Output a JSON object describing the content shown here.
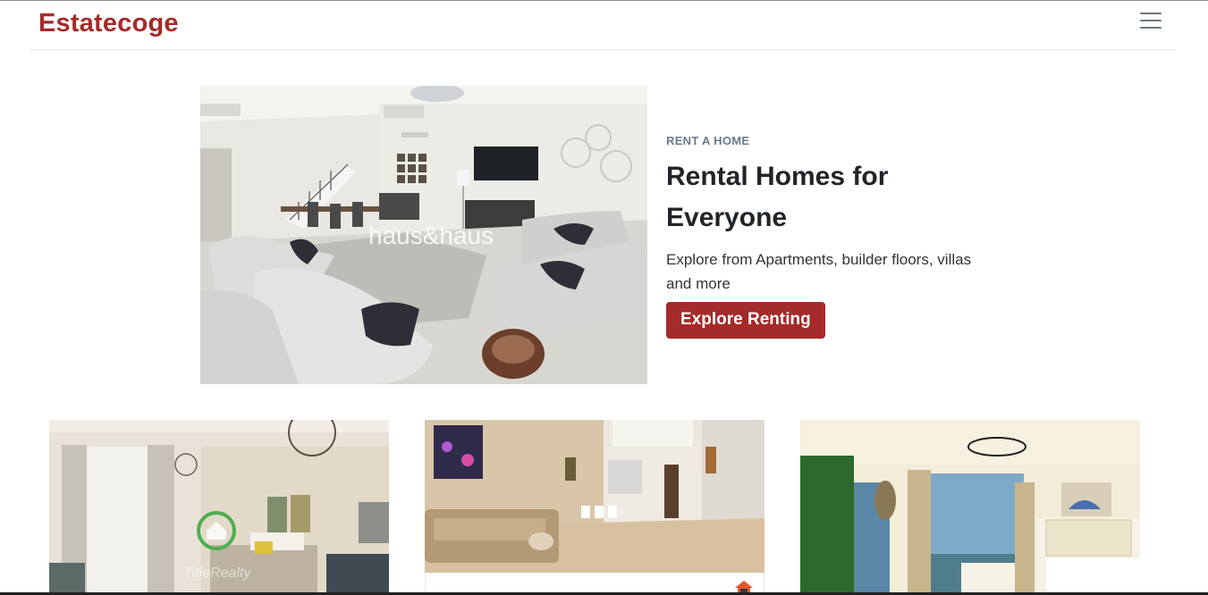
{
  "navbar": {
    "brand": "Estatecoge",
    "menu_icon": "hamburger-menu-icon"
  },
  "hero": {
    "image_watermark": "haus&haus",
    "eyebrow": "RENT A HOME",
    "title_line1": "Rental Homes for",
    "title_line2": "Everyone",
    "description": "Explore from Apartments, builder floors, villas and more",
    "cta_label": "Explore Renting"
  },
  "listings": [
    {
      "image_watermark": "TitleRealty"
    },
    {
      "badge_icon": "home-badge-icon"
    },
    {}
  ],
  "colors": {
    "brand": "#a52a2a",
    "eyebrow": "#6c7a89",
    "text": "#212529"
  }
}
